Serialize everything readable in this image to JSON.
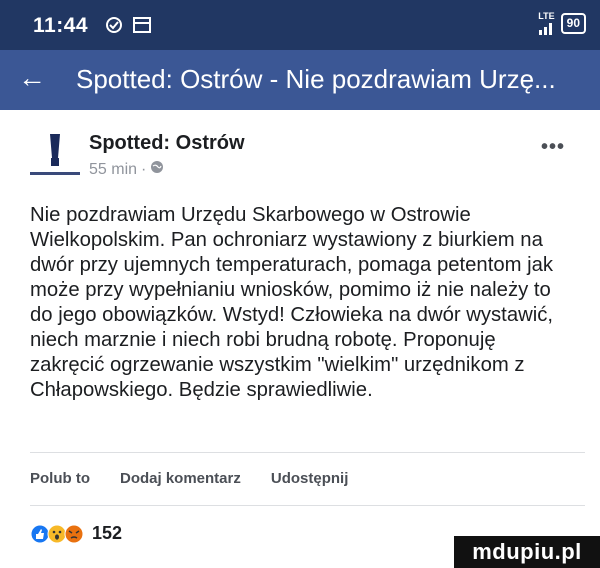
{
  "status_bar": {
    "time": "11:44",
    "network": "LTE",
    "battery": "90"
  },
  "app_bar": {
    "back_icon": "arrow-left-icon",
    "title": "Spotted: Ostrów - Nie pozdrawiam Urzę..."
  },
  "post": {
    "author": "Spotted: Ostrów",
    "time": "55 min",
    "privacy_icon": "globe-icon",
    "more_icon": "more-dots-icon",
    "more_label": "•••",
    "text": "Nie pozdrawiam Urzędu Skarbowego w Ostrowie Wielkopolskim. Pan ochroniarz wystawiony z biurkiem na dwór przy ujemnych temperaturach, pomaga petentom jak może przy wypełnianiu wniosków, pomimo iż nie należy to do jego obowiązków. Wstyd! Człowieka na dwór wystawić, niech marznie i niech robi brudną robotę. Proponuję zakręcić ogrzewanie wszystkim \"wielkim\" urzędnikom z Chłapowskiego. Będzie sprawiedliwie.",
    "actions": {
      "like": "Polub to",
      "comment": "Dodaj komentarz",
      "share": "Udostępnij"
    },
    "reaction_count": "152"
  },
  "watermark": "mdupiu.pl",
  "colors": {
    "status": "#213763",
    "appbar": "#3b5795",
    "like": "#1877f2",
    "wow": "#f7b928",
    "angry": "#e9710f"
  }
}
